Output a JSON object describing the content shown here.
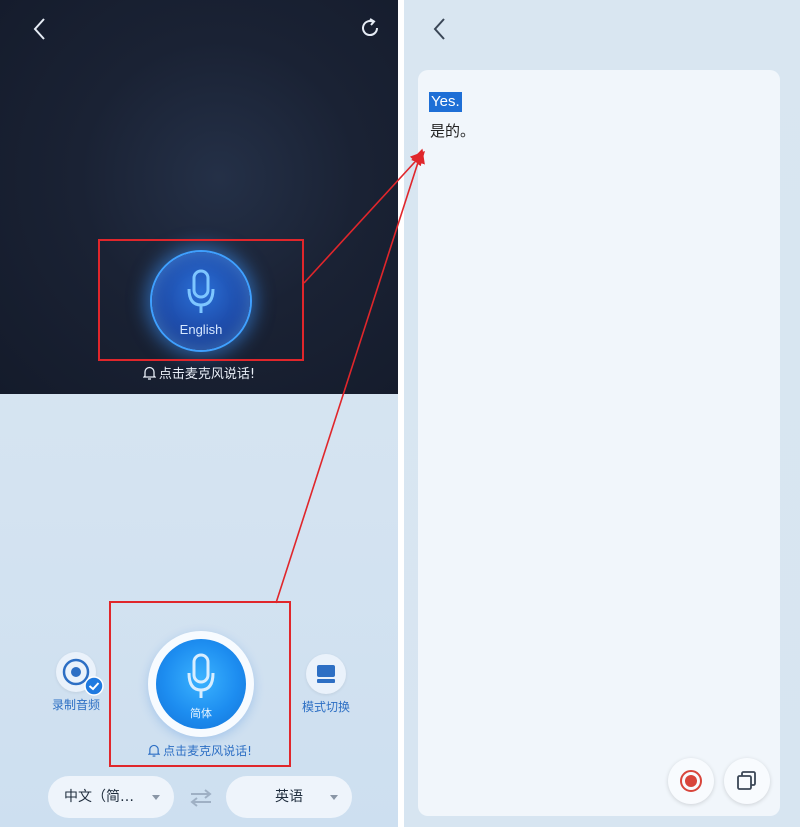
{
  "left": {
    "mic_dark_label": "English",
    "hint_top": "点击麦克风说话!",
    "record_label": "录制音频",
    "mode_label": "模式切换",
    "mic_light_label": "简体",
    "hint_bottom": "点击麦克风说话!",
    "source_lang": "中文（简…",
    "target_lang": "英语"
  },
  "right": {
    "transcript_en": "Yes.",
    "transcript_zh": "是的。"
  },
  "colors": {
    "annotation": "#e0262b",
    "accent": "#1d8df0",
    "selection": "#1e6fd6"
  },
  "icons": [
    "back-icon",
    "refresh-icon",
    "microphone-icon",
    "bell-icon",
    "record-icon",
    "checkmark-icon",
    "mode-switch-icon",
    "swap-icon",
    "copy-icon"
  ]
}
